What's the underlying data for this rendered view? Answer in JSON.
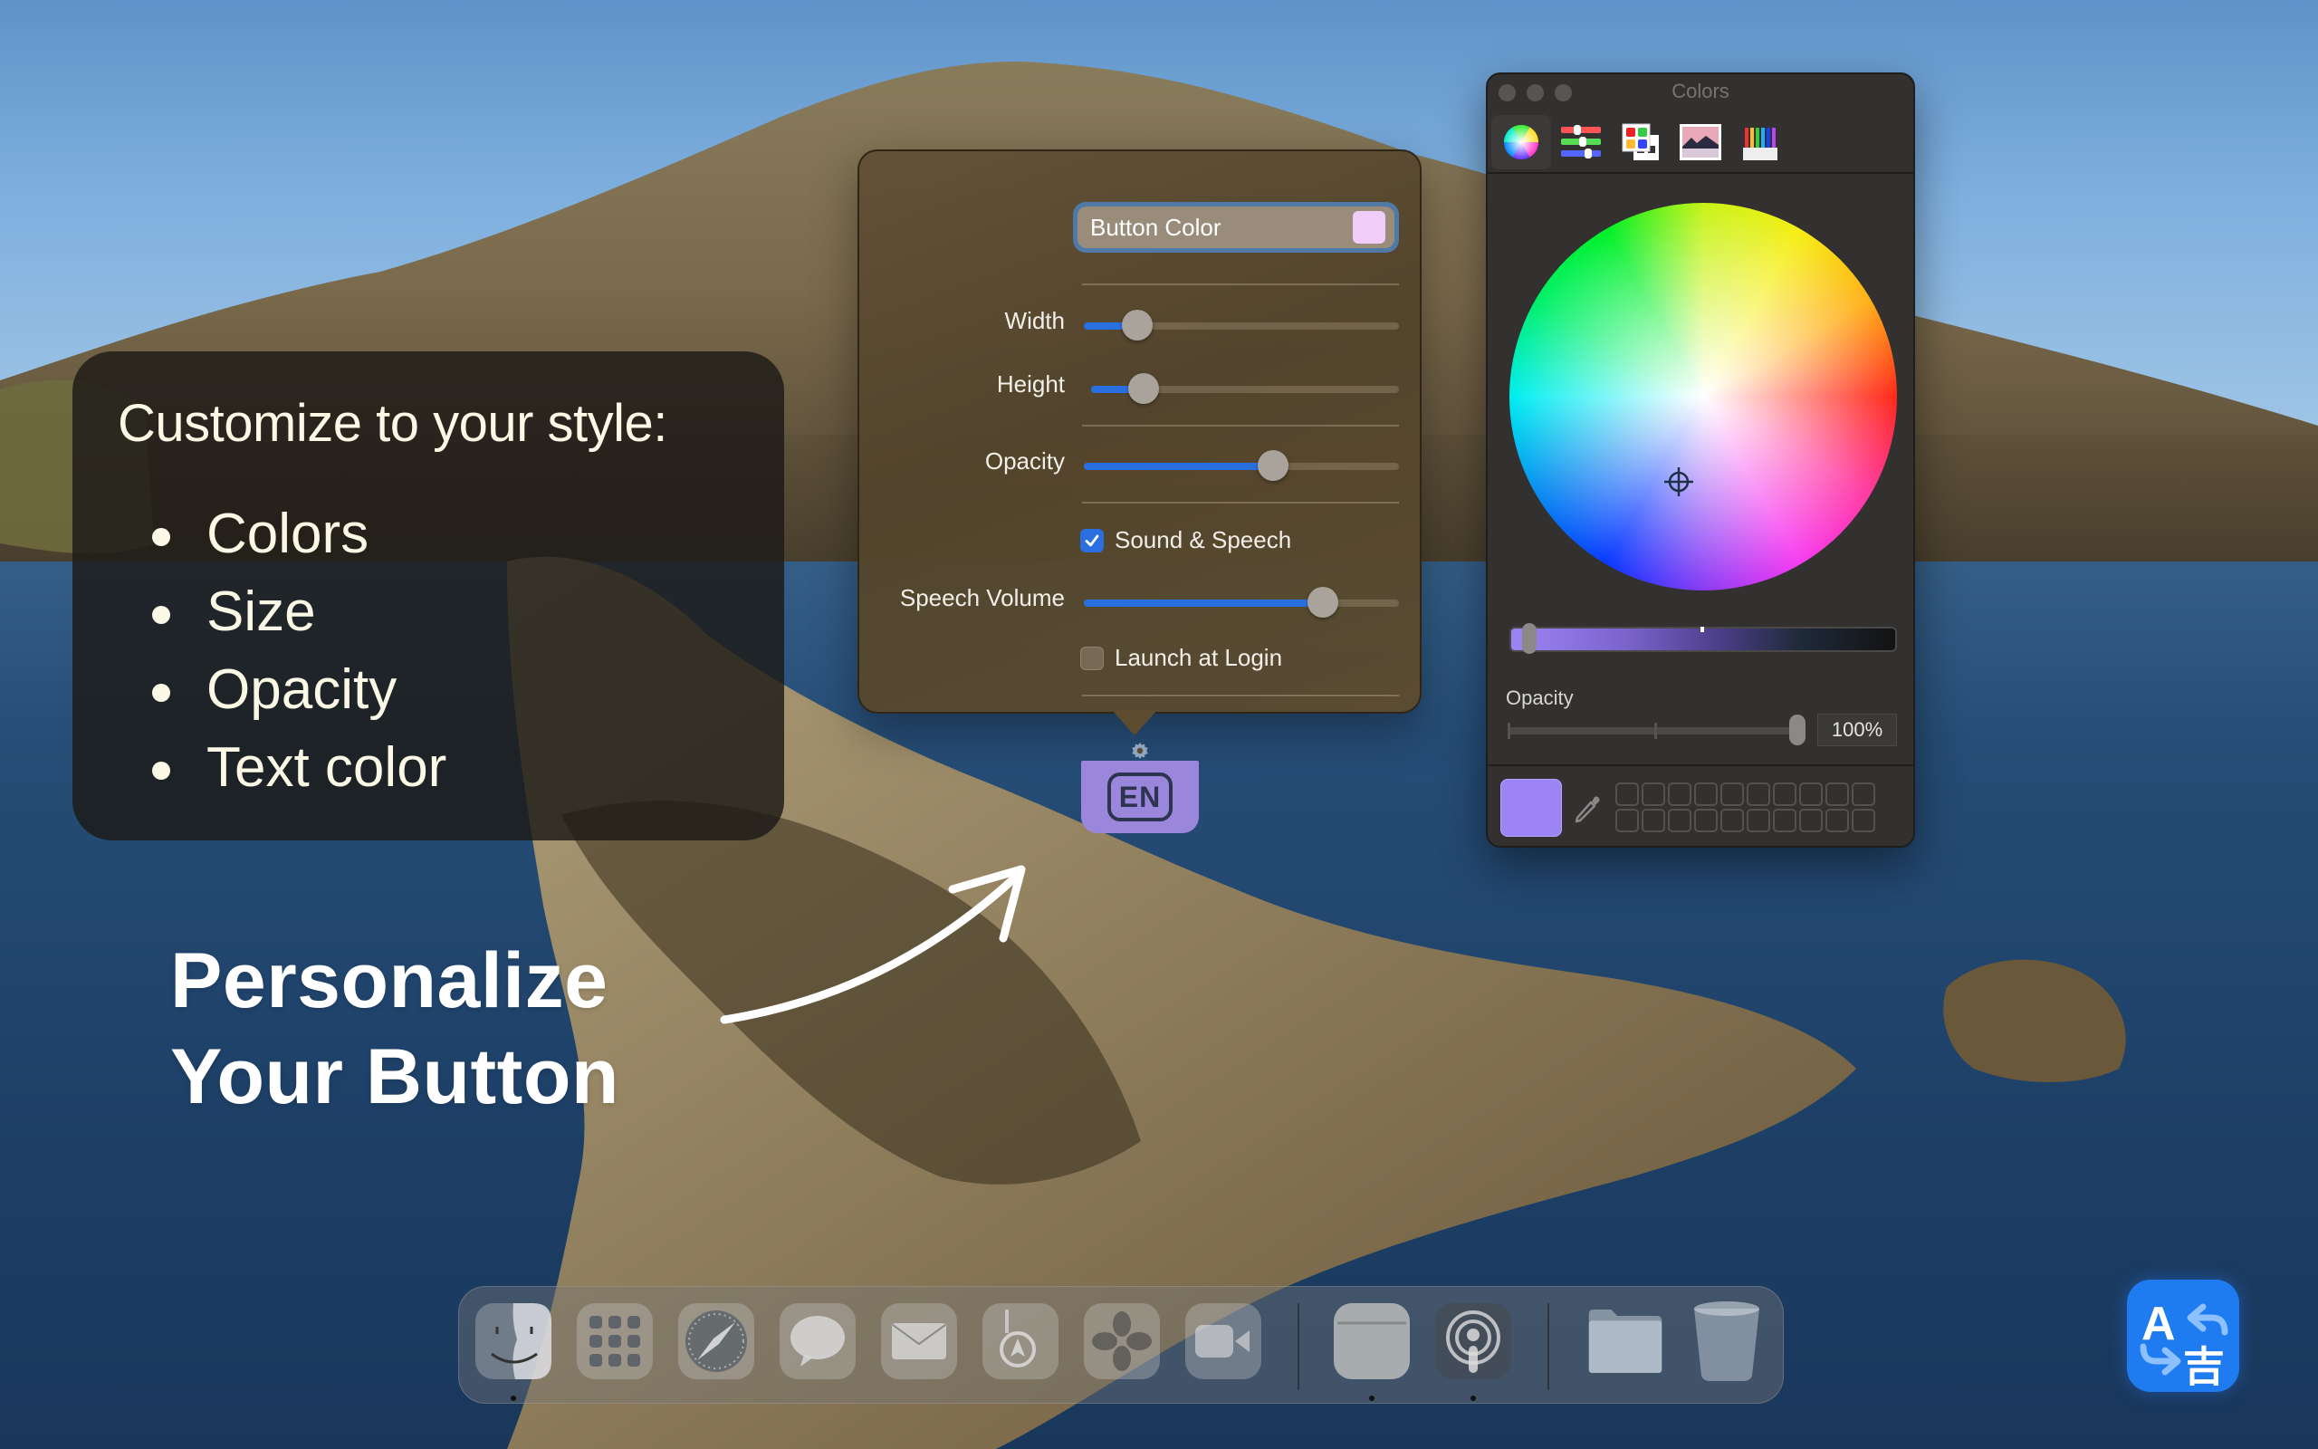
{
  "feature_panel": {
    "title": "Customize to your style:",
    "items": [
      "Colors",
      "Size",
      "Opacity",
      "Text color"
    ]
  },
  "headline": {
    "line1": "Personalize",
    "line2": "Your Button"
  },
  "settings_popover": {
    "button_color": {
      "label": "Button Color",
      "swatch_color": "#f0ccf8"
    },
    "sliders": {
      "width": {
        "label": "Width",
        "value_pct": 17
      },
      "height": {
        "label": "Height",
        "value_pct": 17
      },
      "opacity": {
        "label": "Opacity",
        "value_pct": 60
      },
      "speech_volume": {
        "label": "Speech Volume",
        "value_pct": 76
      }
    },
    "checkboxes": {
      "sound_speech": {
        "label": "Sound & Speech",
        "checked": true
      },
      "launch_login": {
        "label": "Launch at Login",
        "checked": false
      }
    },
    "accent_color": "#2a6fe0"
  },
  "floating_button": {
    "label": "EN",
    "color": "#9a86db"
  },
  "colors_panel": {
    "title": "Colors",
    "modes": [
      {
        "name": "Color Wheel",
        "active": true
      },
      {
        "name": "Color Sliders",
        "active": false
      },
      {
        "name": "Color Palettes",
        "active": false
      },
      {
        "name": "Image Palettes",
        "active": false
      },
      {
        "name": "Pencils",
        "active": false
      }
    ],
    "opacity_label": "Opacity",
    "opacity_value": "100%",
    "brightness_pct": 96,
    "current_color": "#9d84f5",
    "swatch_slots": 20
  },
  "dock": {
    "apps": [
      {
        "name": "Finder",
        "running": true
      },
      {
        "name": "Launchpad",
        "running": false
      },
      {
        "name": "Safari",
        "running": false
      },
      {
        "name": "Messages",
        "running": false
      },
      {
        "name": "Mail",
        "running": false
      },
      {
        "name": "Maps",
        "running": false
      },
      {
        "name": "Photos",
        "running": false
      },
      {
        "name": "FaceTime",
        "running": false
      },
      {
        "name": "Notes",
        "running": true
      },
      {
        "name": "Podcasts",
        "running": true
      },
      {
        "name": "Downloads",
        "running": false
      },
      {
        "name": "Trash",
        "running": false
      }
    ]
  },
  "app_icon": {
    "name": "Translate",
    "glyph_latin": "A",
    "glyph_cjk": "吉",
    "color": "#1e7bf0"
  }
}
